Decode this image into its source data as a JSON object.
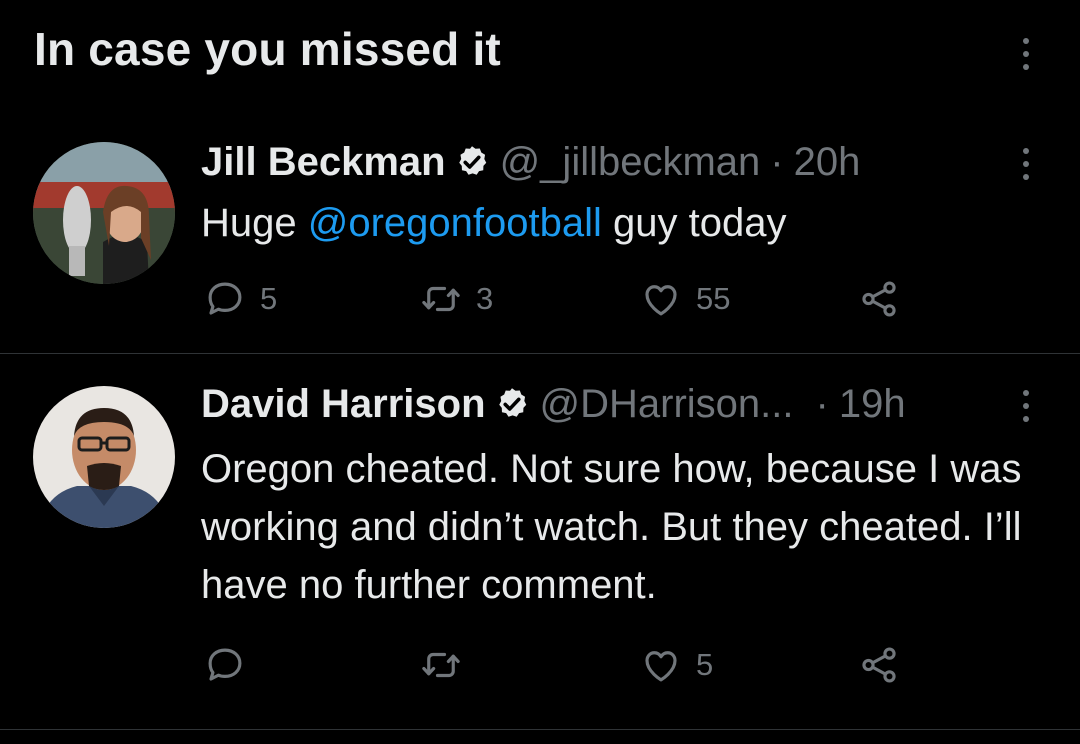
{
  "header": {
    "title": "In case you missed it"
  },
  "tweets": [
    {
      "name": "Jill Beckman",
      "handle": "@_jillbeckman",
      "separator": "·",
      "time": "20h",
      "text_before": "Huge ",
      "mention": "@oregonfootball",
      "text_after": " guy today",
      "replies": "5",
      "retweets": "3",
      "likes": "55"
    },
    {
      "name": "David Harrison",
      "handle": "@DHarrison...",
      "separator": "·",
      "time": "19h",
      "text": "Oregon cheated. Not sure how, because I was working and didn’t watch. But they cheated. I’ll have no further comment.",
      "replies": "",
      "retweets": "",
      "likes": "5"
    }
  ],
  "colors": {
    "background": "#000000",
    "text": "#e7e9ea",
    "muted": "#71767b",
    "link": "#1d9bf0",
    "divider": "#2f3336"
  },
  "icons": [
    "more-icon",
    "verified-icon",
    "reply-icon",
    "retweet-icon",
    "like-icon",
    "share-icon"
  ]
}
